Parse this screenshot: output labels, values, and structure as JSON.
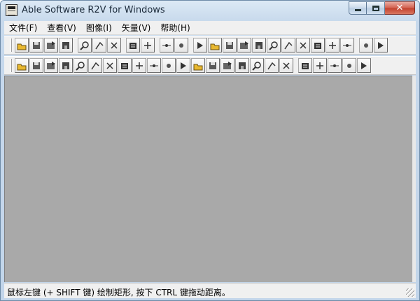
{
  "window": {
    "title": "Able Software R2V for Windows",
    "minimize_icon": "minimize-icon",
    "maximize_icon": "maximize-icon",
    "close_glyph": "✕"
  },
  "menu": {
    "items": [
      {
        "label": "文件(F)"
      },
      {
        "label": "查看(V)"
      },
      {
        "label": "图像(I)"
      },
      {
        "label": "矢量(V)"
      },
      {
        "label": "帮助(H)"
      }
    ]
  },
  "toolbar_main": {
    "icons": [
      "open-folder-icon",
      "save-icon",
      "save-image-icon",
      "save-vector-icon",
      "zoom-in-icon",
      "zoom-out-icon",
      "pan-icon",
      "undo-icon",
      "select-arrow-icon",
      "image-process-icon",
      "image-adjust-icon",
      "texture-icon",
      "frame-icon",
      "fill-square-icon",
      "line-node-icon",
      "line-segment-icon",
      "node-split-icon",
      "point-icon",
      "label-id-icon",
      "point-delete-icon",
      "text-ocr-icon",
      "abc-text-icon",
      "star-point-icon",
      "pick-point-icon"
    ]
  },
  "toolbar_edit": {
    "icons": [
      "line-draw-icon",
      "edit-line-icon",
      "rotate-line-icon",
      "join-line-icon",
      "vertical-split-icon",
      "node-insert-icon",
      "angle-icon",
      "branch-icon",
      "crossing-icon",
      "break-icon",
      "rectangle-icon",
      "line-mirror-icon",
      "line-smooth-icon",
      "horizontal-split-icon",
      "id-line-icon",
      "contour-icon",
      "hatch-icon",
      "solid-block-icon",
      "align-icon",
      "arrow-select-icon",
      "add-node-icon",
      "delete-node-icon",
      "move-node-icon",
      "id-label-icon"
    ]
  },
  "status": {
    "text": "鼠标左键 (+ SHIFT 键) 绘制矩形, 按下 CTRL 键拖动距离。"
  },
  "colors": {
    "workspace": "#a9a9a9",
    "chrome": "#f0f0f0",
    "close_button": "#c2412e"
  }
}
